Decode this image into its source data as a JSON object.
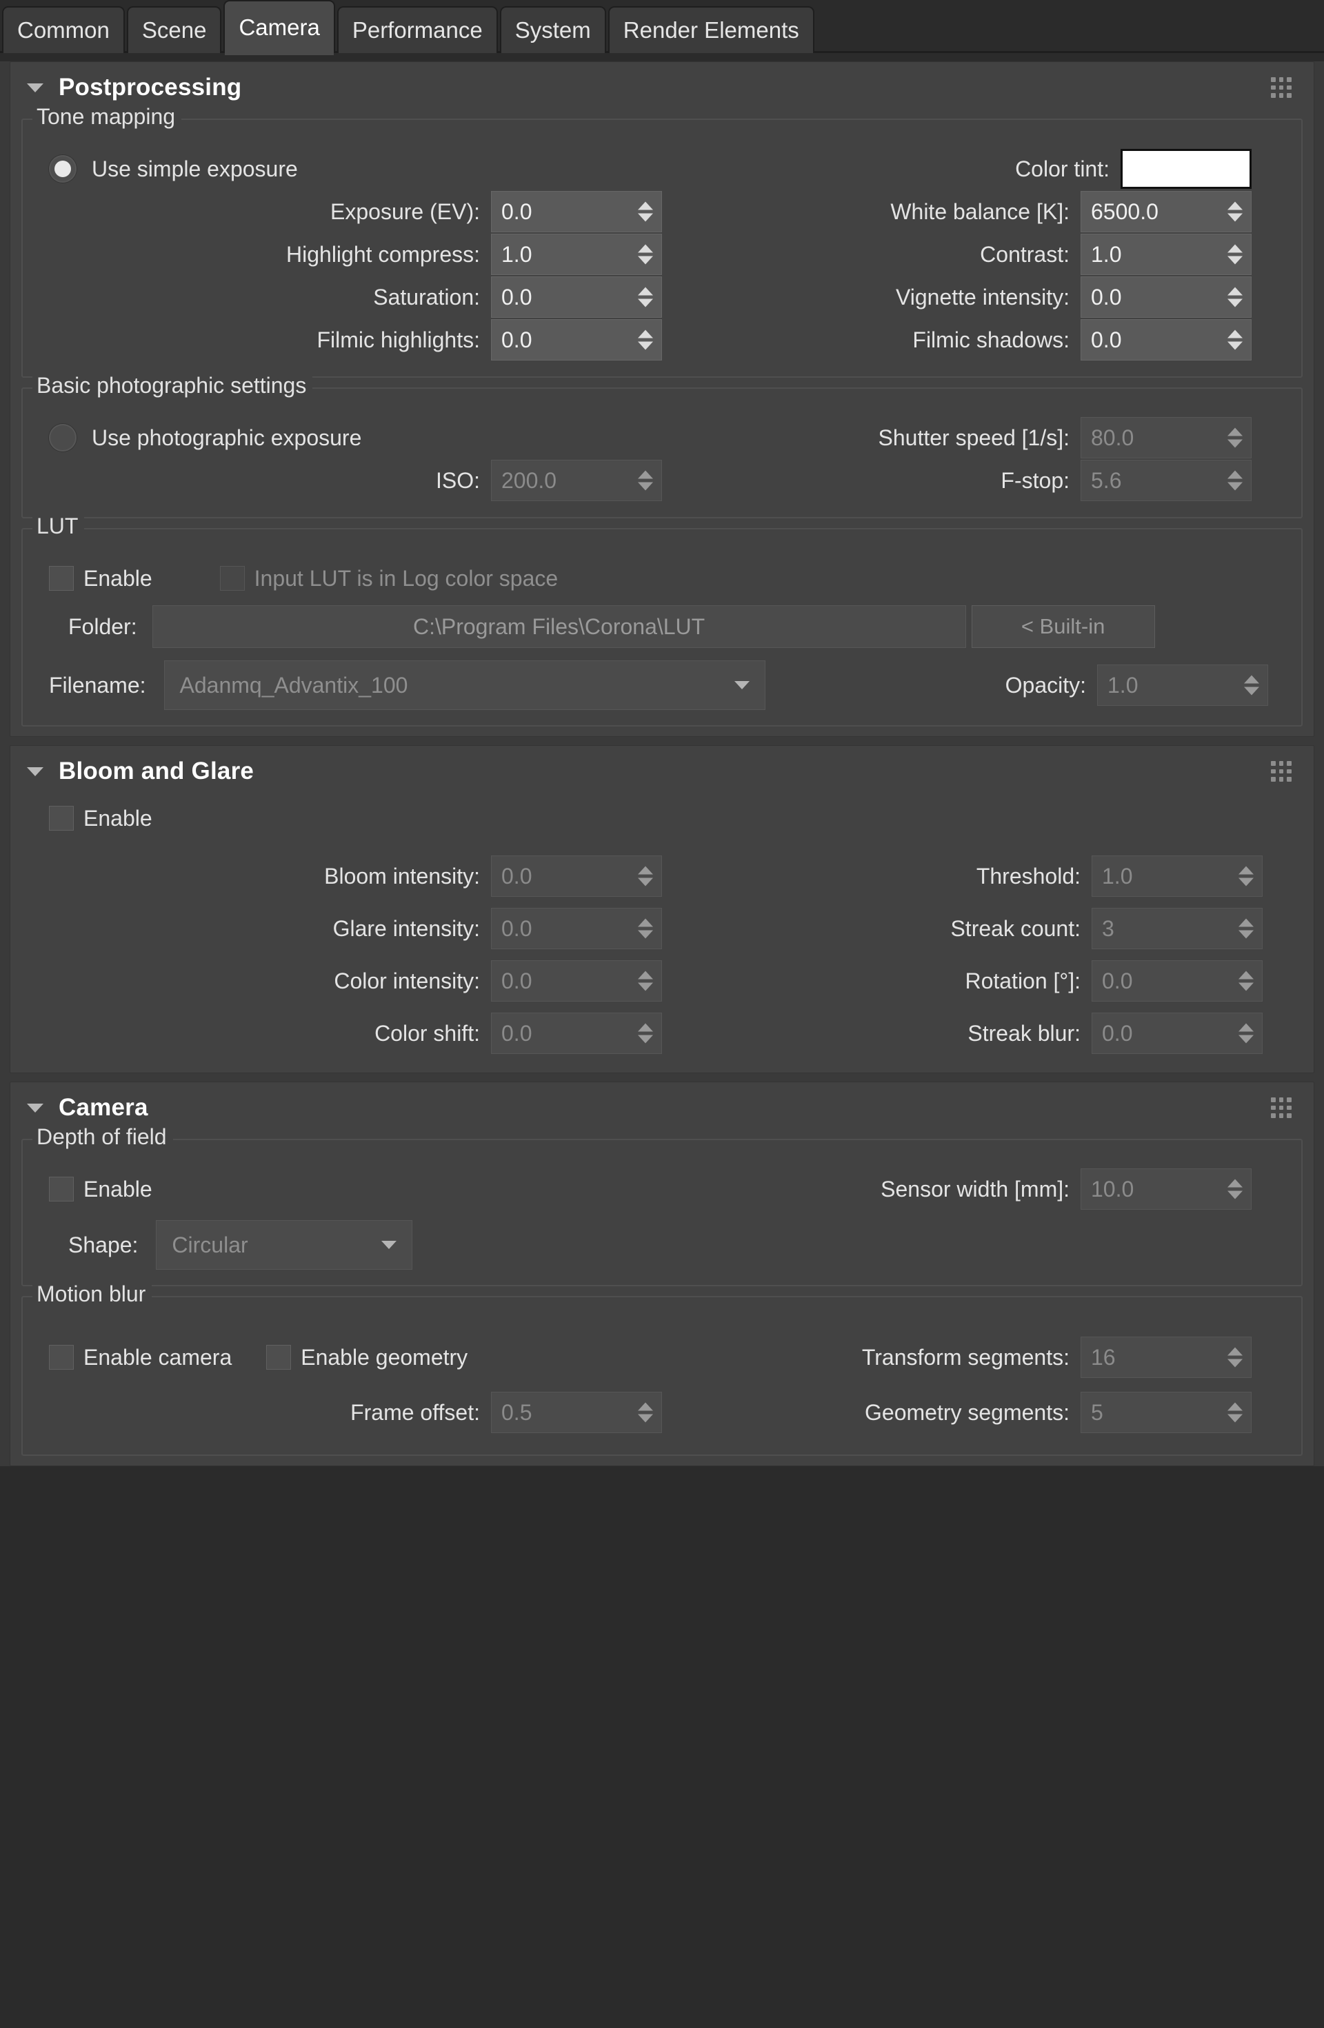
{
  "tabs": [
    {
      "label": "Common",
      "active": false
    },
    {
      "label": "Scene",
      "active": false
    },
    {
      "label": "Camera",
      "active": true
    },
    {
      "label": "Performance",
      "active": false
    },
    {
      "label": "System",
      "active": false
    },
    {
      "label": "Render Elements",
      "active": false
    }
  ],
  "rollouts": {
    "postprocessing": {
      "title": "Postprocessing",
      "tone_mapping": {
        "group_label": "Tone mapping",
        "simple_exposure": {
          "label": "Use simple exposure",
          "selected": true
        },
        "color_tint": {
          "label": "Color tint:",
          "value": "#ffffff"
        },
        "fields": [
          {
            "label": "Exposure (EV):",
            "value": "0.0",
            "disabled": false
          },
          {
            "label": "White balance [K]:",
            "value": "6500.0",
            "disabled": false
          },
          {
            "label": "Highlight compress:",
            "value": "1.0",
            "disabled": false
          },
          {
            "label": "Contrast:",
            "value": "1.0",
            "disabled": false
          },
          {
            "label": "Saturation:",
            "value": "0.0",
            "disabled": false
          },
          {
            "label": "Vignette intensity:",
            "value": "0.0",
            "disabled": false
          },
          {
            "label": "Filmic highlights:",
            "value": "0.0",
            "disabled": false
          },
          {
            "label": "Filmic shadows:",
            "value": "0.0",
            "disabled": false
          }
        ]
      },
      "basic_photographic": {
        "group_label": "Basic photographic settings",
        "photographic_exposure": {
          "label": "Use photographic exposure",
          "selected": false
        },
        "fields": [
          {
            "label": "Shutter speed [1/s]:",
            "value": "80.0",
            "disabled": true
          },
          {
            "label": "ISO:",
            "value": "200.0",
            "disabled": true
          },
          {
            "label": "F-stop:",
            "value": "5.6",
            "disabled": true
          }
        ]
      },
      "lut": {
        "group_label": "LUT",
        "enable": {
          "label": "Enable",
          "checked": false
        },
        "log_space": {
          "label": "Input LUT is in Log color space",
          "checked": false
        },
        "folder_label": "Folder:",
        "folder_value": "C:\\Program Files\\Corona\\LUT",
        "builtin_button": "< Built-in",
        "filename_label": "Filename:",
        "filename_value": "Adanmq_Advantix_100",
        "opacity_label": "Opacity:",
        "opacity_value": "1.0"
      }
    },
    "bloom_glare": {
      "title": "Bloom and Glare",
      "enable": {
        "label": "Enable",
        "checked": false
      },
      "fields": [
        {
          "label": "Bloom intensity:",
          "value": "0.0",
          "disabled": true
        },
        {
          "label": "Threshold:",
          "value": "1.0",
          "disabled": true
        },
        {
          "label": "Glare intensity:",
          "value": "0.0",
          "disabled": true
        },
        {
          "label": "Streak count:",
          "value": "3",
          "disabled": true
        },
        {
          "label": "Color intensity:",
          "value": "0.0",
          "disabled": true
        },
        {
          "label": "Rotation  [°]:",
          "value": "0.0",
          "disabled": true
        },
        {
          "label": "Color shift:",
          "value": "0.0",
          "disabled": true
        },
        {
          "label": "Streak blur:",
          "value": "0.0",
          "disabled": true
        }
      ]
    },
    "camera": {
      "title": "Camera",
      "depth_of_field": {
        "group_label": "Depth of field",
        "enable": {
          "label": "Enable",
          "checked": false
        },
        "sensor_width": {
          "label": "Sensor width [mm]:",
          "value": "10.0",
          "disabled": true
        },
        "shape": {
          "label": "Shape:",
          "value": "Circular",
          "disabled": true
        }
      },
      "motion_blur": {
        "group_label": "Motion blur",
        "enable_camera": {
          "label": "Enable camera",
          "checked": false
        },
        "enable_geometry": {
          "label": "Enable geometry",
          "checked": false
        },
        "fields": [
          {
            "label": "Transform segments:",
            "value": "16",
            "disabled": true
          },
          {
            "label": "Frame offset:",
            "value": "0.5",
            "disabled": true
          },
          {
            "label": "Geometry segments:",
            "value": "5",
            "disabled": true
          }
        ]
      }
    }
  }
}
